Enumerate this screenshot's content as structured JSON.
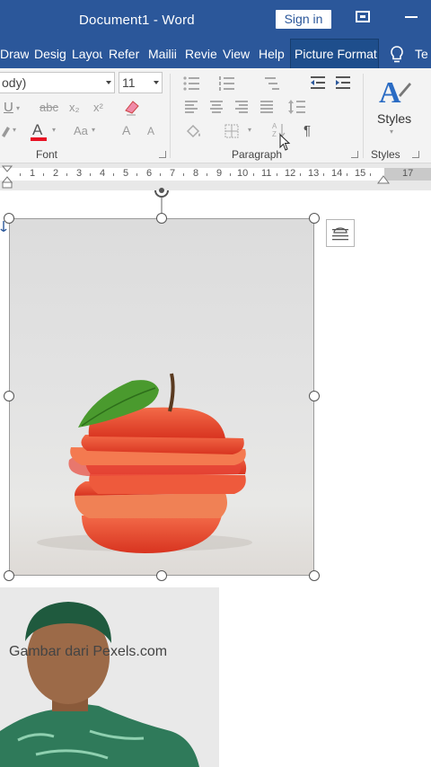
{
  "titlebar": {
    "title": "Document1  -  Word",
    "sign_in": "Sign in"
  },
  "tabs": [
    {
      "label": "Draw"
    },
    {
      "label": "Desig"
    },
    {
      "label": "Layou"
    },
    {
      "label": "Refer"
    },
    {
      "label": "Mailii"
    },
    {
      "label": "Revie"
    },
    {
      "label": "View"
    },
    {
      "label": "Help"
    },
    {
      "label": "Picture Format"
    }
  ],
  "tell_me": "Te",
  "ribbon": {
    "font_name": "ody)",
    "font_size": "11",
    "font_group_label": "Font",
    "paragraph_group_label": "Paragraph",
    "styles_group_label": "Styles",
    "styles_button": "Styles",
    "underline_glyph": "U",
    "strike_glyph": "abc",
    "subscript_glyph": "x₂",
    "superscript_glyph": "x²",
    "font_color_glyph": "A",
    "change_case_glyph": "Aa",
    "grow_font_glyph": "A",
    "shrink_font_glyph": "A",
    "pilcrow_glyph": "¶",
    "font_color_hex": "#e81123"
  },
  "ruler": {
    "numbers": [
      "1",
      "2",
      "3",
      "4",
      "5",
      "6",
      "7",
      "8",
      "9",
      "10",
      "11",
      "12",
      "13",
      "14",
      "15",
      "17"
    ]
  },
  "document": {
    "watermark_text": "Gambar dari Pexels.com"
  },
  "colors": {
    "word_blue": "#2b579a",
    "apple_red": "#e0402a",
    "leaf_green": "#4a9a2e"
  }
}
